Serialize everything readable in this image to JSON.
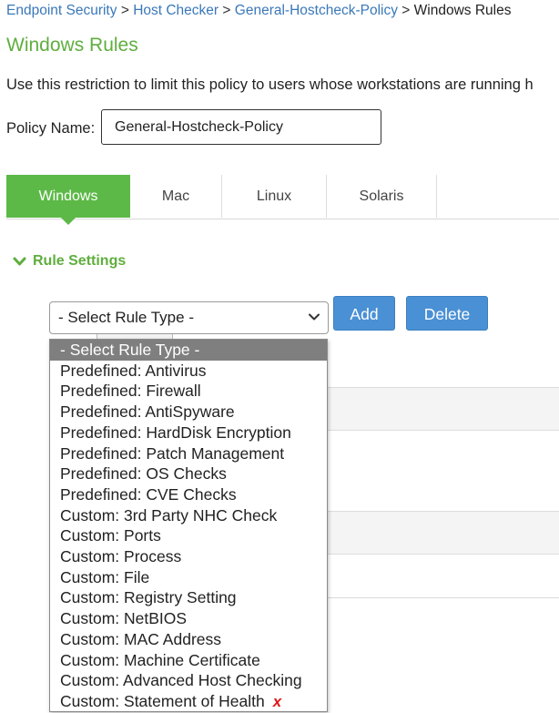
{
  "breadcrumb": {
    "items": [
      "Endpoint Security",
      "Host Checker",
      "General-Hostcheck-Policy"
    ],
    "current": "Windows Rules",
    "separator": ">"
  },
  "page": {
    "title": "Windows Rules",
    "description": "Use this restriction to limit this policy to users whose workstations are running h"
  },
  "policy": {
    "label": "Policy Name:",
    "value": "General-Hostcheck-Policy"
  },
  "tabs": [
    {
      "label": "Windows",
      "active": true
    },
    {
      "label": "Mac",
      "active": false
    },
    {
      "label": "Linux",
      "active": false
    },
    {
      "label": "Solaris",
      "active": false
    }
  ],
  "rule_settings": {
    "label": "Rule Settings",
    "select_value": "- Select Rule Type -",
    "add_label": "Add",
    "delete_label": "Delete"
  },
  "dropdown": {
    "options": [
      "- Select Rule Type -",
      "Predefined: Antivirus",
      "Predefined: Firewall",
      "Predefined: AntiSpyware",
      "Predefined: HardDisk Encryption",
      "Predefined: Patch Management",
      "Predefined: OS Checks",
      "Predefined: CVE Checks",
      "Custom: 3rd Party NHC Check",
      "Custom: Ports",
      "Custom: Process",
      "Custom: File",
      "Custom: Registry Setting",
      "Custom: NetBIOS",
      "Custom: MAC Address",
      "Custom: Machine Certificate",
      "Custom: Advanced Host Checking",
      "Custom: Statement of Health"
    ],
    "selected_index": 0,
    "marked_option": "Custom: Statement of Health",
    "mark_glyph": "x"
  },
  "colors": {
    "accent_green": "#5cb947",
    "button_blue": "#4a90d4",
    "link_blue": "#3a78b8",
    "mark_red": "#e0181b"
  }
}
